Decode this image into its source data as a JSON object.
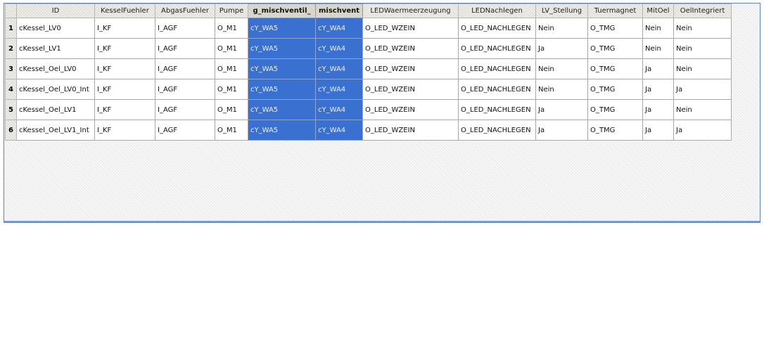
{
  "columns": [
    {
      "label": "ID",
      "selected": false
    },
    {
      "label": "KesselFuehler",
      "selected": false
    },
    {
      "label": "AbgasFuehler",
      "selected": false
    },
    {
      "label": "Pumpe",
      "selected": false
    },
    {
      "label": "g_mischventil_",
      "selected": true
    },
    {
      "label": "mischvent",
      "selected": true
    },
    {
      "label": "LEDWaermeerzeugung",
      "selected": false
    },
    {
      "label": "LEDNachlegen",
      "selected": false
    },
    {
      "label": "LV_Stellung",
      "selected": false
    },
    {
      "label": "Tuermagnet",
      "selected": false
    },
    {
      "label": "MitOel",
      "selected": false
    },
    {
      "label": "OelIntegriert",
      "selected": false
    }
  ],
  "rows": [
    {
      "num": "1",
      "cells": [
        "cKessel_LV0",
        "I_KF",
        "I_AGF",
        "O_M1",
        "cY_WA5",
        "cY_WA4",
        "O_LED_WZEIN",
        "O_LED_NACHLEGEN",
        "Nein",
        "O_TMG",
        "Nein",
        "Nein"
      ]
    },
    {
      "num": "2",
      "cells": [
        "cKessel_LV1",
        "I_KF",
        "I_AGF",
        "O_M1",
        "cY_WA5",
        "cY_WA4",
        "O_LED_WZEIN",
        "O_LED_NACHLEGEN",
        "Ja",
        "O_TMG",
        "Nein",
        "Nein"
      ]
    },
    {
      "num": "3",
      "cells": [
        "cKessel_Oel_LV0",
        "I_KF",
        "I_AGF",
        "O_M1",
        "cY_WA5",
        "cY_WA4",
        "O_LED_WZEIN",
        "O_LED_NACHLEGEN",
        "Nein",
        "O_TMG",
        "Ja",
        "Nein"
      ]
    },
    {
      "num": "4",
      "cells": [
        "cKessel_Oel_LV0_Int",
        "I_KF",
        "I_AGF",
        "O_M1",
        "cY_WA5",
        "cY_WA4",
        "O_LED_WZEIN",
        "O_LED_NACHLEGEN",
        "Nein",
        "O_TMG",
        "Ja",
        "Ja"
      ]
    },
    {
      "num": "5",
      "cells": [
        "cKessel_Oel_LV1",
        "I_KF",
        "I_AGF",
        "O_M1",
        "cY_WA5",
        "cY_WA4",
        "O_LED_WZEIN",
        "O_LED_NACHLEGEN",
        "Ja",
        "O_TMG",
        "Ja",
        "Nein"
      ]
    },
    {
      "num": "6",
      "cells": [
        "cKessel_Oel_LV1_Int",
        "I_KF",
        "I_AGF",
        "O_M1",
        "cY_WA5",
        "cY_WA4",
        "O_LED_WZEIN",
        "O_LED_NACHLEGEN",
        "Ja",
        "O_TMG",
        "Ja",
        "Ja"
      ]
    }
  ],
  "colors": {
    "selection": "#3a70cf",
    "frame_border": "#5f83b9",
    "header_bg": "#ecebe5"
  }
}
